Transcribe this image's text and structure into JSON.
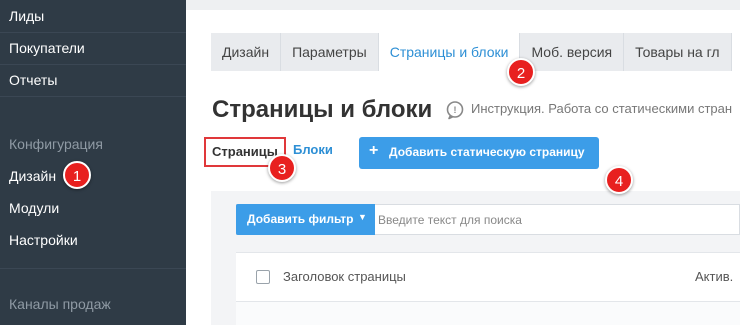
{
  "sidebar": {
    "items": [
      {
        "label": "Лиды"
      },
      {
        "label": "Покупатели"
      },
      {
        "label": "Отчеты"
      },
      {
        "label": "Конфигурация"
      },
      {
        "label": "Дизайн"
      },
      {
        "label": "Модули"
      },
      {
        "label": "Настройки"
      },
      {
        "label": "Каналы продаж"
      }
    ]
  },
  "tabs": [
    {
      "label": "Дизайн"
    },
    {
      "label": "Параметры"
    },
    {
      "label": "Страницы и блоки"
    },
    {
      "label": "Моб. версия"
    },
    {
      "label": "Товары на гл"
    }
  ],
  "page": {
    "title": "Страницы и блоки",
    "help_text": "Инструкция. Работа со статическими стран"
  },
  "subtabs": {
    "pages": "Страницы",
    "blocks": "Блоки"
  },
  "add_page_button": {
    "label": "Добавить статическую страницу",
    "icon": "plus-icon"
  },
  "filter": {
    "button_label": "Добавить фильтр",
    "search_placeholder": "Введите текст для поиска"
  },
  "table": {
    "columns": [
      "Заголовок страницы",
      "Актив."
    ]
  },
  "callouts": [
    "1",
    "2",
    "3",
    "4"
  ],
  "colors": {
    "sidebar_bg": "#2f3b46",
    "accent": "#3c9de8",
    "link": "#2d8fd5",
    "callout": "#e8201f"
  }
}
